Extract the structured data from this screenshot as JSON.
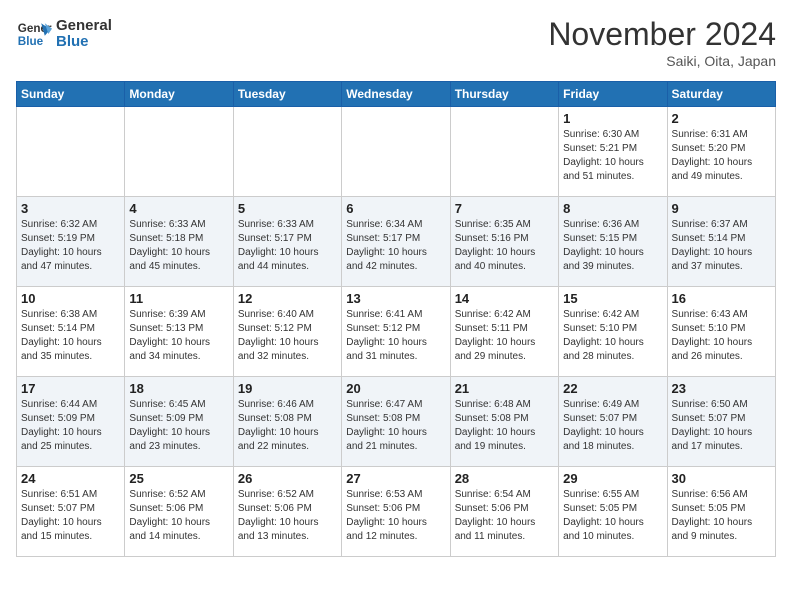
{
  "header": {
    "logo_line1": "General",
    "logo_line2": "Blue",
    "month": "November 2024",
    "location": "Saiki, Oita, Japan"
  },
  "weekdays": [
    "Sunday",
    "Monday",
    "Tuesday",
    "Wednesday",
    "Thursday",
    "Friday",
    "Saturday"
  ],
  "weeks": [
    [
      {
        "day": "",
        "info": ""
      },
      {
        "day": "",
        "info": ""
      },
      {
        "day": "",
        "info": ""
      },
      {
        "day": "",
        "info": ""
      },
      {
        "day": "",
        "info": ""
      },
      {
        "day": "1",
        "info": "Sunrise: 6:30 AM\nSunset: 5:21 PM\nDaylight: 10 hours and 51 minutes."
      },
      {
        "day": "2",
        "info": "Sunrise: 6:31 AM\nSunset: 5:20 PM\nDaylight: 10 hours and 49 minutes."
      }
    ],
    [
      {
        "day": "3",
        "info": "Sunrise: 6:32 AM\nSunset: 5:19 PM\nDaylight: 10 hours and 47 minutes."
      },
      {
        "day": "4",
        "info": "Sunrise: 6:33 AM\nSunset: 5:18 PM\nDaylight: 10 hours and 45 minutes."
      },
      {
        "day": "5",
        "info": "Sunrise: 6:33 AM\nSunset: 5:17 PM\nDaylight: 10 hours and 44 minutes."
      },
      {
        "day": "6",
        "info": "Sunrise: 6:34 AM\nSunset: 5:17 PM\nDaylight: 10 hours and 42 minutes."
      },
      {
        "day": "7",
        "info": "Sunrise: 6:35 AM\nSunset: 5:16 PM\nDaylight: 10 hours and 40 minutes."
      },
      {
        "day": "8",
        "info": "Sunrise: 6:36 AM\nSunset: 5:15 PM\nDaylight: 10 hours and 39 minutes."
      },
      {
        "day": "9",
        "info": "Sunrise: 6:37 AM\nSunset: 5:14 PM\nDaylight: 10 hours and 37 minutes."
      }
    ],
    [
      {
        "day": "10",
        "info": "Sunrise: 6:38 AM\nSunset: 5:14 PM\nDaylight: 10 hours and 35 minutes."
      },
      {
        "day": "11",
        "info": "Sunrise: 6:39 AM\nSunset: 5:13 PM\nDaylight: 10 hours and 34 minutes."
      },
      {
        "day": "12",
        "info": "Sunrise: 6:40 AM\nSunset: 5:12 PM\nDaylight: 10 hours and 32 minutes."
      },
      {
        "day": "13",
        "info": "Sunrise: 6:41 AM\nSunset: 5:12 PM\nDaylight: 10 hours and 31 minutes."
      },
      {
        "day": "14",
        "info": "Sunrise: 6:42 AM\nSunset: 5:11 PM\nDaylight: 10 hours and 29 minutes."
      },
      {
        "day": "15",
        "info": "Sunrise: 6:42 AM\nSunset: 5:10 PM\nDaylight: 10 hours and 28 minutes."
      },
      {
        "day": "16",
        "info": "Sunrise: 6:43 AM\nSunset: 5:10 PM\nDaylight: 10 hours and 26 minutes."
      }
    ],
    [
      {
        "day": "17",
        "info": "Sunrise: 6:44 AM\nSunset: 5:09 PM\nDaylight: 10 hours and 25 minutes."
      },
      {
        "day": "18",
        "info": "Sunrise: 6:45 AM\nSunset: 5:09 PM\nDaylight: 10 hours and 23 minutes."
      },
      {
        "day": "19",
        "info": "Sunrise: 6:46 AM\nSunset: 5:08 PM\nDaylight: 10 hours and 22 minutes."
      },
      {
        "day": "20",
        "info": "Sunrise: 6:47 AM\nSunset: 5:08 PM\nDaylight: 10 hours and 21 minutes."
      },
      {
        "day": "21",
        "info": "Sunrise: 6:48 AM\nSunset: 5:08 PM\nDaylight: 10 hours and 19 minutes."
      },
      {
        "day": "22",
        "info": "Sunrise: 6:49 AM\nSunset: 5:07 PM\nDaylight: 10 hours and 18 minutes."
      },
      {
        "day": "23",
        "info": "Sunrise: 6:50 AM\nSunset: 5:07 PM\nDaylight: 10 hours and 17 minutes."
      }
    ],
    [
      {
        "day": "24",
        "info": "Sunrise: 6:51 AM\nSunset: 5:07 PM\nDaylight: 10 hours and 15 minutes."
      },
      {
        "day": "25",
        "info": "Sunrise: 6:52 AM\nSunset: 5:06 PM\nDaylight: 10 hours and 14 minutes."
      },
      {
        "day": "26",
        "info": "Sunrise: 6:52 AM\nSunset: 5:06 PM\nDaylight: 10 hours and 13 minutes."
      },
      {
        "day": "27",
        "info": "Sunrise: 6:53 AM\nSunset: 5:06 PM\nDaylight: 10 hours and 12 minutes."
      },
      {
        "day": "28",
        "info": "Sunrise: 6:54 AM\nSunset: 5:06 PM\nDaylight: 10 hours and 11 minutes."
      },
      {
        "day": "29",
        "info": "Sunrise: 6:55 AM\nSunset: 5:05 PM\nDaylight: 10 hours and 10 minutes."
      },
      {
        "day": "30",
        "info": "Sunrise: 6:56 AM\nSunset: 5:05 PM\nDaylight: 10 hours and 9 minutes."
      }
    ]
  ]
}
